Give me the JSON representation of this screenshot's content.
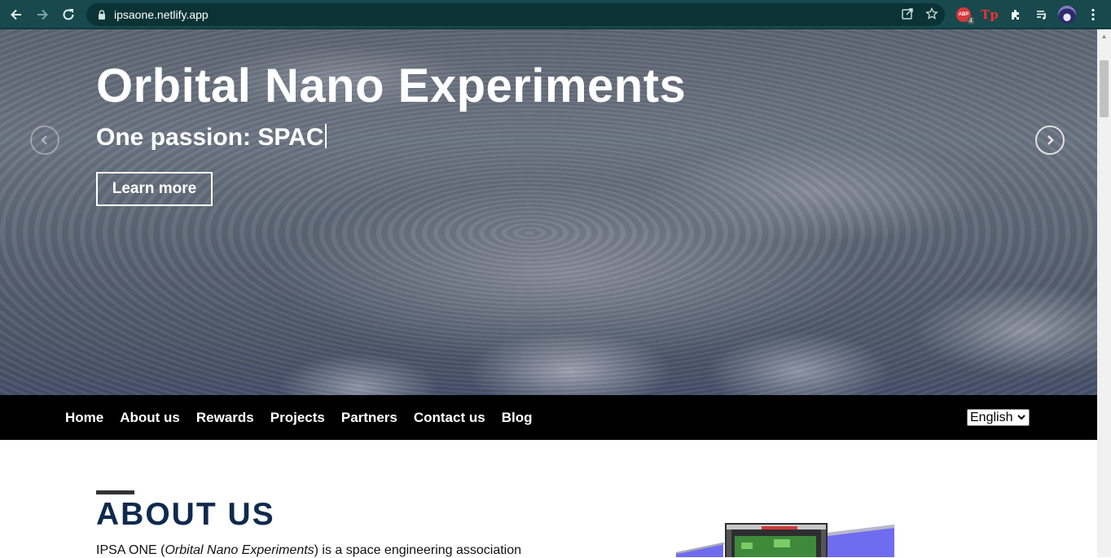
{
  "browser": {
    "url": "ipsaone.netlify.app",
    "extensions": {
      "adblock_label": "ABP",
      "adblock_count": "4",
      "tp_label": "Tp"
    }
  },
  "hero": {
    "title": "Orbital Nano Experiments",
    "subtitle": "One passion: SPAC",
    "cta_label": "Learn more"
  },
  "nav": {
    "items": [
      "Home",
      "About us",
      "Rewards",
      "Projects",
      "Partners",
      "Contact us",
      "Blog"
    ],
    "language_selected": "English"
  },
  "about": {
    "heading": "ABOUT US",
    "text_prefix": "IPSA ONE (",
    "text_italic": "Orbital Nano Experiments",
    "text_suffix": ") is a space engineering association"
  }
}
